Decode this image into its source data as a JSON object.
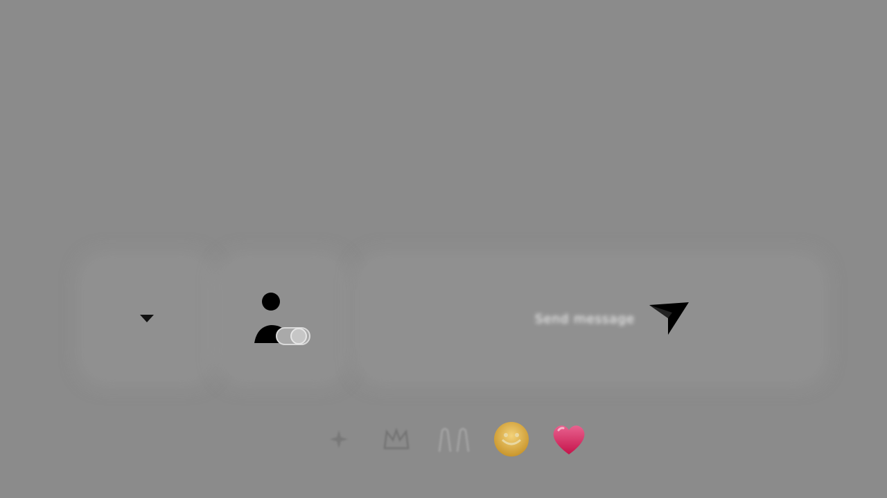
{
  "composer": {
    "send_hint_text": "Send message"
  },
  "icons": {
    "dropdown": "caret-down-icon",
    "contacts": "person-with-toggle-icon",
    "send": "paper-plane-icon"
  },
  "reactions": [
    {
      "name": "sparkle-reaction-icon"
    },
    {
      "name": "crown-reaction-icon"
    },
    {
      "name": "hands-reaction-icon"
    },
    {
      "name": "smiley-reaction-icon",
      "color": "#e2b340"
    },
    {
      "name": "heart-reaction-icon",
      "color": "#e01e5a"
    }
  ]
}
